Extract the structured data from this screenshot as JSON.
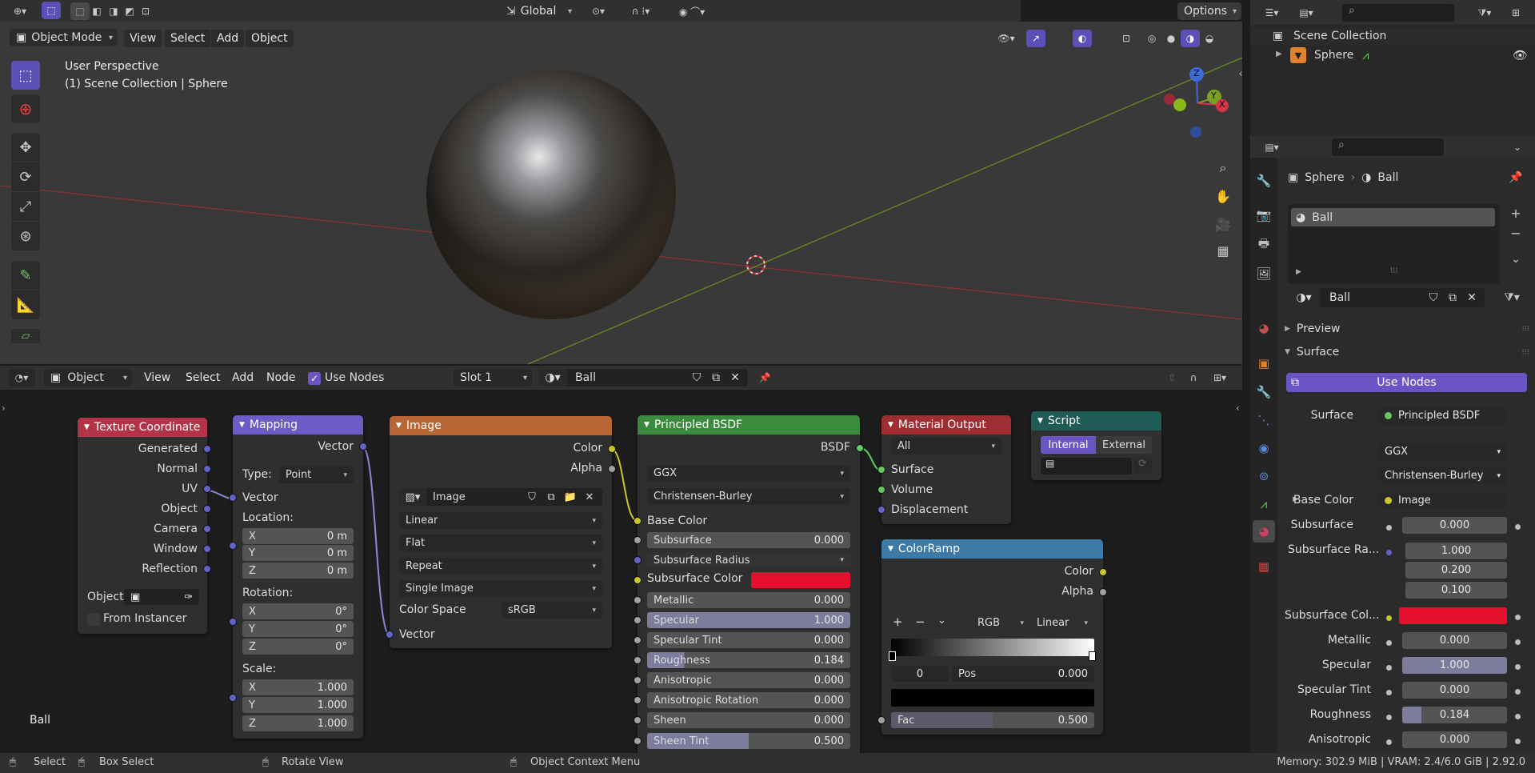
{
  "topbar": {
    "transform_orientation": "Global",
    "options": "Options"
  },
  "viewport_header": {
    "mode": "Object Mode",
    "menus": [
      "View",
      "Select",
      "Add",
      "Object"
    ]
  },
  "viewport": {
    "perspective": "User Perspective",
    "collection": "(1) Scene Collection | Sphere",
    "gizmo": {
      "z": "Z",
      "y": "Y",
      "x": "X"
    }
  },
  "outliner": {
    "scene_collection": "Scene Collection",
    "object": "Sphere"
  },
  "node_header": {
    "type": "Object",
    "menus": [
      "View",
      "Select",
      "Add",
      "Node"
    ],
    "use_nodes": "Use Nodes",
    "slot": "Slot 1",
    "material": "Ball"
  },
  "nodes": {
    "texcoord": {
      "title": "Texture Coordinate",
      "outputs": [
        "Generated",
        "Normal",
        "UV",
        "Object",
        "Camera",
        "Window",
        "Reflection"
      ],
      "object_label": "Object:",
      "from_instancer": "From Instancer"
    },
    "mapping": {
      "title": "Mapping",
      "vector_out": "Vector",
      "type_label": "Type:",
      "type_value": "Point",
      "vector_in": "Vector",
      "location": "Location:",
      "rotation": "Rotation:",
      "scale": "Scale:",
      "axes": [
        "X",
        "Y",
        "Z"
      ],
      "loc_values": [
        "0 m",
        "0 m",
        "0 m"
      ],
      "rot_values": [
        "0°",
        "0°",
        "0°"
      ],
      "scale_values": [
        "1.000",
        "1.000",
        "1.000"
      ]
    },
    "image": {
      "title": "Image",
      "color": "Color",
      "alpha": "Alpha",
      "image_name": "Image",
      "interp": "Linear",
      "proj": "Flat",
      "ext": "Repeat",
      "source": "Single Image",
      "cs_label": "Color Space",
      "cs_value": "sRGB",
      "vector": "Vector"
    },
    "bsdf": {
      "title": "Principled BSDF",
      "bsdf_out": "BSDF",
      "dist": "GGX",
      "sss_method": "Christensen-Burley",
      "base_color": "Base Color",
      "rows": [
        {
          "label": "Subsurface",
          "value": "0.000"
        },
        {
          "label": "Subsurface Radius",
          "value": ""
        },
        {
          "label": "Subsurface Color",
          "value": ""
        },
        {
          "label": "Metallic",
          "value": "0.000"
        },
        {
          "label": "Specular",
          "value": "1.000"
        },
        {
          "label": "Specular Tint",
          "value": "0.000"
        },
        {
          "label": "Roughness",
          "value": "0.184"
        },
        {
          "label": "Anisotropic",
          "value": "0.000"
        },
        {
          "label": "Anisotropic Rotation",
          "value": "0.000"
        },
        {
          "label": "Sheen",
          "value": "0.000"
        },
        {
          "label": "Sheen Tint",
          "value": "0.500"
        }
      ],
      "specular_fill": 1.0,
      "roughness_fill": 0.184,
      "sheen_tint_fill": 0.5
    },
    "output": {
      "title": "Material Output",
      "target": "All",
      "inputs": [
        "Surface",
        "Volume",
        "Displacement"
      ]
    },
    "colorramp": {
      "title": "ColorRamp",
      "color": "Color",
      "alpha": "Alpha",
      "mode": "RGB",
      "interp": "Linear",
      "index": "0",
      "pos_label": "Pos",
      "pos_value": "0.000",
      "fac_label": "Fac",
      "fac_value": "0.500",
      "fac_fill": 0.5
    },
    "script": {
      "title": "Script",
      "internal": "Internal",
      "external": "External"
    }
  },
  "node_label": "Ball",
  "properties": {
    "breadcrumb_object": "Sphere",
    "breadcrumb_material": "Ball",
    "slot_item": "Ball",
    "material_name": "Ball",
    "preview": "Preview",
    "surface_panel": "Surface",
    "use_nodes": "Use Nodes",
    "surface_label": "Surface",
    "surface_value": "Principled BSDF",
    "dist": "GGX",
    "sss_method": "Christensen-Burley",
    "base_color_label": "Base Color",
    "base_color_value": "Image",
    "subsurface_label": "Subsurface",
    "subsurface_value": "0.000",
    "ssr_label": "Subsurface Ra...",
    "ssr_values": [
      "1.000",
      "0.200",
      "0.100"
    ],
    "ssc_label": "Subsurface Col...",
    "metallic_label": "Metallic",
    "metallic_value": "0.000",
    "specular_label": "Specular",
    "specular_value": "1.000",
    "spec_tint_label": "Specular Tint",
    "spec_tint_value": "0.000",
    "roughness_label": "Roughness",
    "roughness_value": "0.184",
    "aniso_label": "Anisotropic",
    "aniso_value": "0.000"
  },
  "statusbar": {
    "select": "Select",
    "box_select": "Box Select",
    "rotate": "Rotate View",
    "context": "Object Context Menu",
    "memory": "Memory: 302.9 MiB | VRAM: 2.4/6.0 GiB | 2.92.0"
  },
  "colors": {
    "accent": "#6b55c4",
    "subsurface_red": "#e4102c",
    "texcoord_header": "#b33447",
    "mapping_header": "#6e5cc6",
    "image_header": "#b86634",
    "bsdf_header": "#3c8a3e",
    "output_header": "#9e2e32",
    "colorramp_header": "#3d7aa5",
    "script_header": "#1f5c55"
  }
}
